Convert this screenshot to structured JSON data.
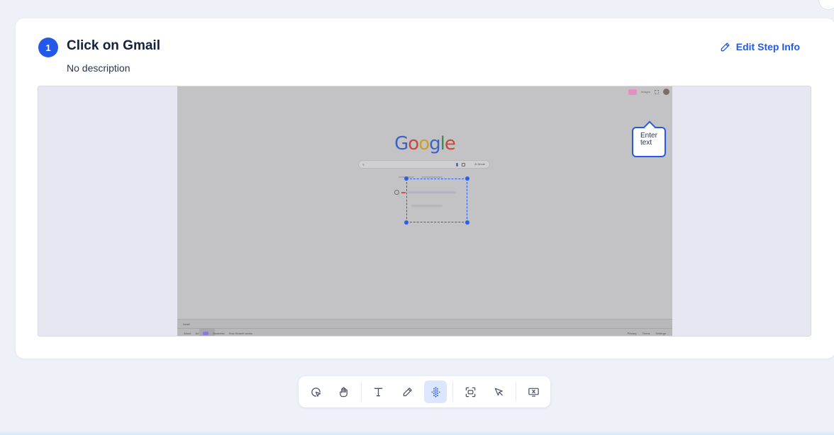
{
  "step": {
    "number": "1",
    "title": "Click on Gmail",
    "description": "No description",
    "edit_label": "Edit Step Info"
  },
  "screenshot": {
    "logo_letters": [
      "G",
      "o",
      "o",
      "g",
      "l",
      "e"
    ],
    "topbar_text": "Images",
    "search_ai_label": "AI Mode",
    "tooltip_text": "Enter text",
    "footer": {
      "country": "Israel",
      "left_links": [
        "About",
        "Ad",
        "Business",
        "How Search works"
      ],
      "right_links": [
        "Privacy",
        "Terms",
        "Settings"
      ]
    }
  },
  "toolbar": {
    "tools": [
      {
        "icon": "click-cursor-icon",
        "active": false
      },
      {
        "icon": "hover-hand-icon",
        "active": false
      },
      {
        "icon": "text-icon",
        "active": false
      },
      {
        "icon": "pen-icon",
        "active": false
      },
      {
        "icon": "blur-dots-icon",
        "active": true
      },
      {
        "icon": "capture-area-icon",
        "active": false
      },
      {
        "icon": "pointer-cursor-icon",
        "active": false
      },
      {
        "icon": "remove-screen-icon",
        "active": false
      }
    ]
  },
  "colors": {
    "accent": "#2459e8",
    "active_tool_bg": "#dde6ff",
    "page_bg": "#eef1f8"
  }
}
